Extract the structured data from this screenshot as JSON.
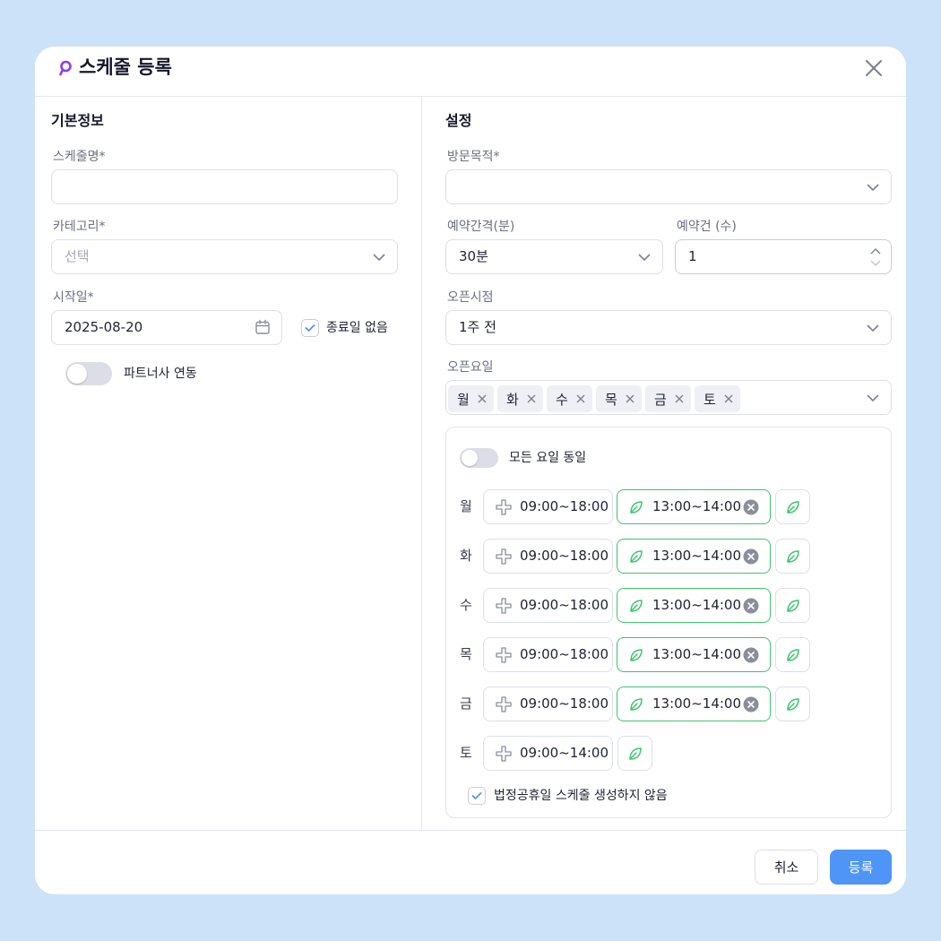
{
  "modal": {
    "title": "스케줄 등록",
    "accent_color": "#8b3ff0"
  },
  "left": {
    "section_title": "기본정보",
    "schedule_name": {
      "label": "스케줄명*",
      "value": ""
    },
    "category": {
      "label": "카테고리*",
      "placeholder": "선택"
    },
    "start_date": {
      "label": "시작일*",
      "value": "2025-08-20"
    },
    "no_end_date": {
      "label": "종료일 없음",
      "checked": true
    },
    "partner_link": {
      "label": "파트너사 연동",
      "on": false
    }
  },
  "right": {
    "section_title": "설정",
    "visit_purpose": {
      "label": "방문목적*",
      "value": ""
    },
    "interval": {
      "label": "예약간격(분)",
      "value": "30분"
    },
    "count": {
      "label": "예약건 (수)",
      "value": "1"
    },
    "open_time": {
      "label": "오픈시점",
      "value": "1주 전"
    },
    "open_days": {
      "label": "오픈요일",
      "chips": [
        "월",
        "화",
        "수",
        "목",
        "금",
        "토"
      ]
    },
    "same_all_days": {
      "label": "모든 요일 동일",
      "on": false
    },
    "schedule": [
      {
        "day": "월",
        "hours": "09:00~18:00",
        "break": "13:00~14:00"
      },
      {
        "day": "화",
        "hours": "09:00~18:00",
        "break": "13:00~14:00"
      },
      {
        "day": "수",
        "hours": "09:00~18:00",
        "break": "13:00~14:00"
      },
      {
        "day": "목",
        "hours": "09:00~18:00",
        "break": "13:00~14:00"
      },
      {
        "day": "금",
        "hours": "09:00~18:00",
        "break": "13:00~14:00"
      },
      {
        "day": "토",
        "hours": "09:00~14:00",
        "break": ""
      }
    ],
    "skip_holidays": {
      "label": "법정공휴일 스케줄 생성하지 않음",
      "checked": true
    }
  },
  "footer": {
    "cancel_label": "취소",
    "submit_label": "등록",
    "submit_color": "#4f94f7"
  },
  "colors": {
    "break_border": "#3ec46d",
    "check": "#4f94f7"
  }
}
